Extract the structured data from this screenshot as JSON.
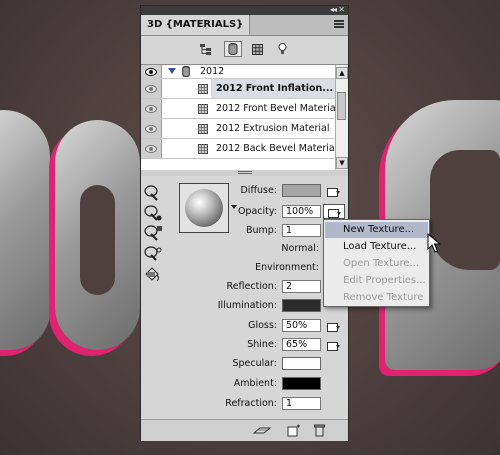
{
  "panel": {
    "title": "3D {MATERIALS}"
  },
  "filters": [
    {
      "name": "scene",
      "icon": "scene-tree-icon"
    },
    {
      "name": "mesh",
      "icon": "mesh-cylinder-icon"
    },
    {
      "name": "materials",
      "icon": "materials-grid-icon"
    },
    {
      "name": "lights",
      "icon": "light-bulb-icon"
    }
  ],
  "layers": {
    "root": "2012",
    "items": [
      {
        "label": "2012 Front Inflation..."
      },
      {
        "label": "2012 Front Bevel Material"
      },
      {
        "label": "2012 Extrusion Material"
      },
      {
        "label": "2012 Back Bevel Material"
      }
    ]
  },
  "properties": {
    "diffuse_label": "Diffuse:",
    "opacity_label": "Opacity:",
    "opacity_value": "100%",
    "bump_label": "Bump:",
    "bump_value": "1",
    "normal_label": "Normal:",
    "environment_label": "Environment:",
    "reflection_label": "Reflection:",
    "reflection_value": "2",
    "illumination_label": "Illumination:",
    "gloss_label": "Gloss:",
    "gloss_value": "50%",
    "shine_label": "Shine:",
    "shine_value": "65%",
    "specular_label": "Specular:",
    "ambient_label": "Ambient:",
    "refraction_label": "Refraction:",
    "refraction_value": "1"
  },
  "colors": {
    "diffuse": "#a6a6a6",
    "illumination": "#2b2b2b",
    "specular": "#ffffff",
    "ambient": "#000000",
    "background": "#4f4040",
    "accent_pink": "#e0236f"
  },
  "context_menu": {
    "items": [
      {
        "label": "New Texture...",
        "enabled": true,
        "highlighted": true
      },
      {
        "label": "Load Texture...",
        "enabled": true,
        "highlighted": false
      },
      {
        "label": "Open Texture...",
        "enabled": false,
        "highlighted": false
      },
      {
        "label": "Edit Properties...",
        "enabled": false,
        "highlighted": false
      },
      {
        "label": "Remove Texture",
        "enabled": false,
        "highlighted": false
      }
    ]
  }
}
